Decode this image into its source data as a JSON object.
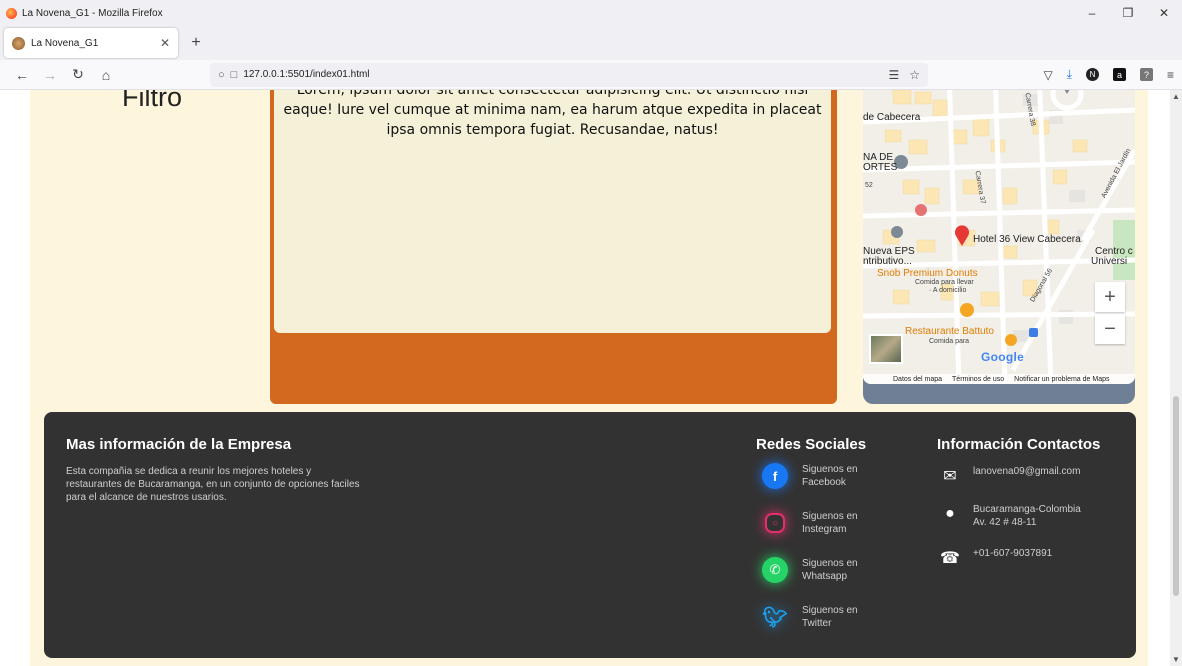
{
  "browser": {
    "window_title": "La Novena_G1 - Mozilla Firefox",
    "tab_title": "La Novena_G1",
    "url": "127.0.0.1:5501/index01.html"
  },
  "main": {
    "filter_heading": "Filtro",
    "lorem_text": "Lorem, ipsum dolor sit amet consectetur adipisicing elit. Ut distinctio nisi eaque! Iure vel cumque at minima nam, ea harum atque expedita in placeat ipsa omnis tempora fugiat. Recusandae, natus!"
  },
  "map": {
    "labels": {
      "cabecera": "de Cabecera",
      "nade": "NA DE",
      "ortes": "ORTES",
      "hotel": "Hotel 36 View Cabecera",
      "centro": "Centro c",
      "univ": "Universi",
      "eps": "Nueva EPS",
      "tributivo": "ntributivo...",
      "snob": "Snob Premium Donuts",
      "snob_sub1": "Comida para llevar",
      "snob_sub2": "· A domicilio",
      "restaurante": "Restaurante Battuto",
      "rest_sub": "Comida para",
      "diagonal": "Diagonal 56",
      "carrera37": "Carrera 37",
      "carrera38": "Carrera 38",
      "avenida": "Avenida El Jardín",
      "n52": "52"
    },
    "zoom_in": "+",
    "zoom_out": "−",
    "google": "Google",
    "credits": {
      "data": "Datos del mapa",
      "terms": "Términos de uso",
      "report": "Notificar un problema de Maps"
    }
  },
  "footer": {
    "about": {
      "title": "Mas información de la Empresa",
      "text": "Esta compañia se dedica a reunir los mejores hoteles y restaurantes de Bucaramanga, en un conjunto de opciones faciles para el alcance de nuestros usarios."
    },
    "social": {
      "title": "Redes Sociales",
      "items": [
        {
          "text": "Siguenos en Facebook"
        },
        {
          "text": "Siguenos en Instegram"
        },
        {
          "text": "Siguenos en Whatsapp"
        },
        {
          "text": "Siguenos en Twitter"
        }
      ]
    },
    "contact": {
      "title": "Información Contactos",
      "email": "lanovena09@gmail.com",
      "address": "Bucaramanga-Colombia Av. 42 # 48-11",
      "phone": "+01-607-9037891"
    }
  }
}
